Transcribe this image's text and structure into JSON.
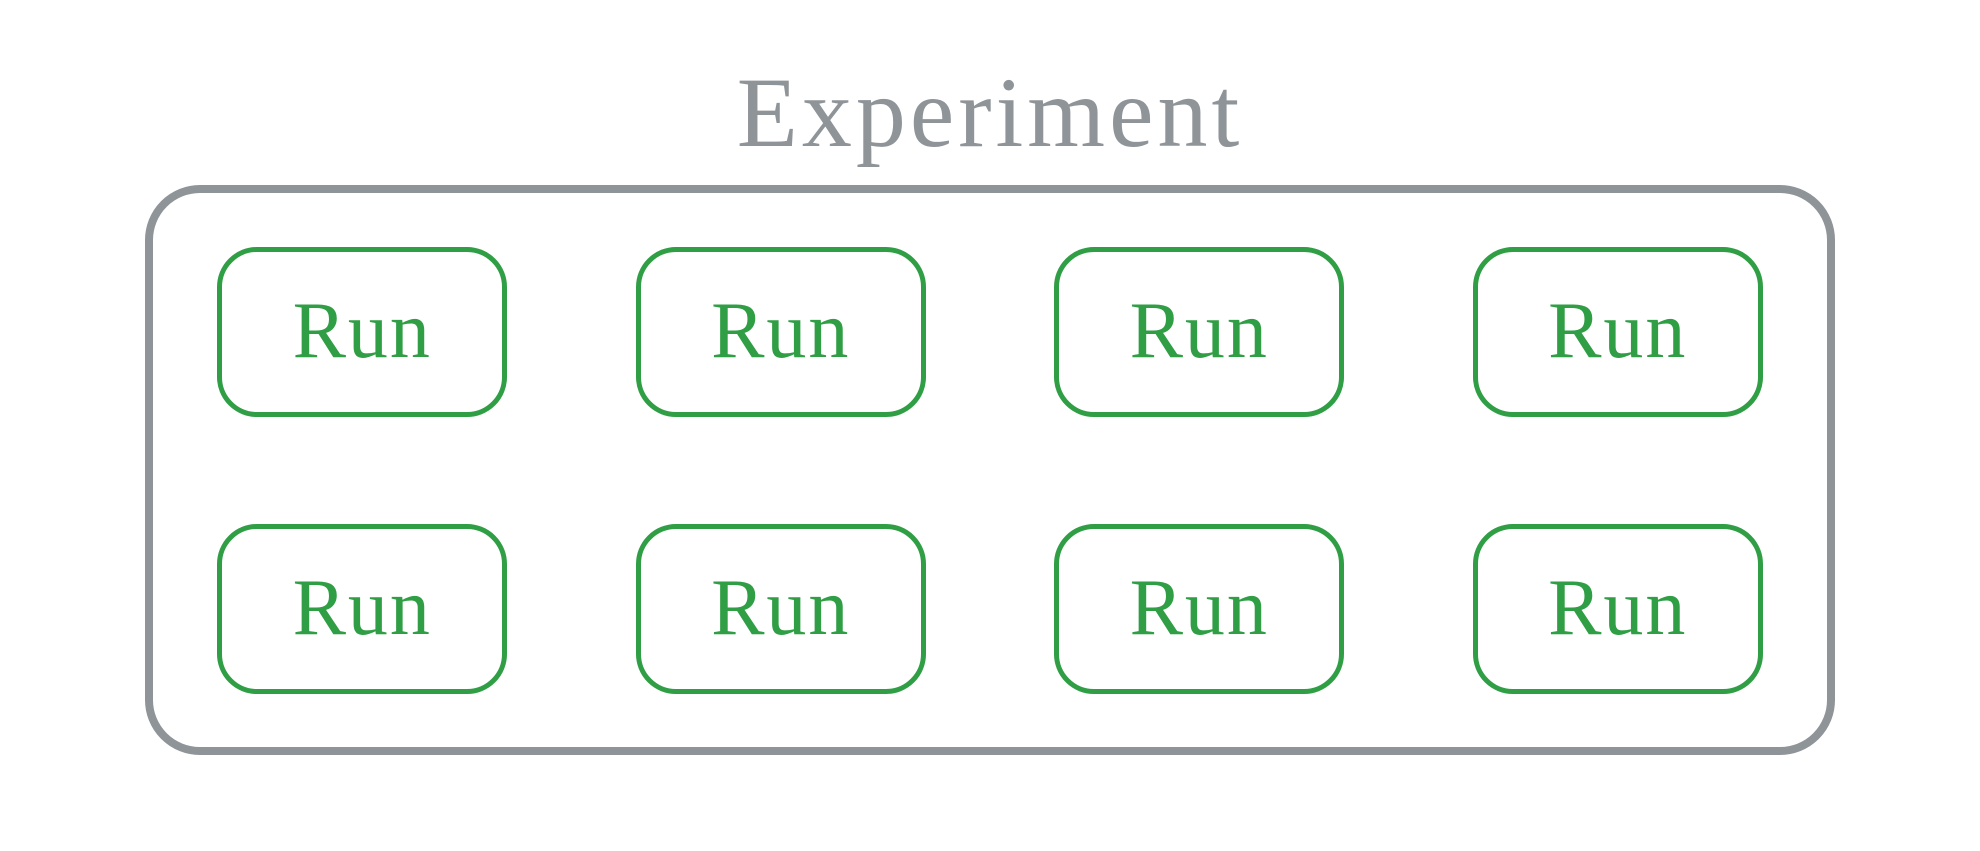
{
  "title": "Experiment",
  "colors": {
    "title_gray": "#8f9499",
    "container_border": "#8f9499",
    "run_green": "#2f9e44"
  },
  "runs": [
    {
      "label": "Run"
    },
    {
      "label": "Run"
    },
    {
      "label": "Run"
    },
    {
      "label": "Run"
    },
    {
      "label": "Run"
    },
    {
      "label": "Run"
    },
    {
      "label": "Run"
    },
    {
      "label": "Run"
    }
  ]
}
